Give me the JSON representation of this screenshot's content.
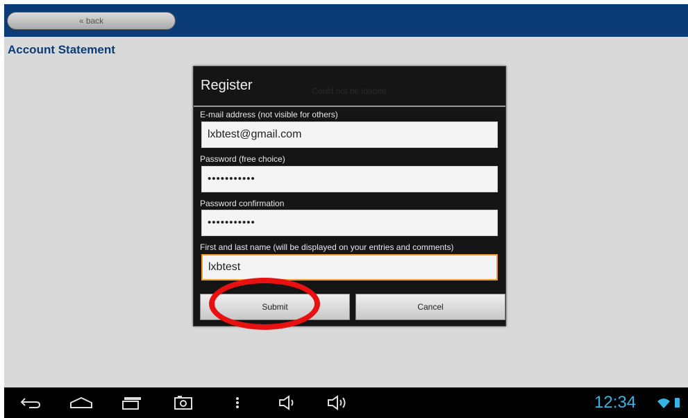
{
  "topbar": {
    "back_label": "« back"
  },
  "page": {
    "title": "Account Statement"
  },
  "dialog": {
    "title": "Register",
    "ghost_text": "Could not be loaded",
    "fields": [
      {
        "label": "E-mail address (not visible for others)",
        "value": "lxbtest@gmail.com",
        "type": "text"
      },
      {
        "label": "Password (free choice)",
        "value": "•••••••••••",
        "type": "password"
      },
      {
        "label": "Password confirmation",
        "value": "•••••••••••",
        "type": "password"
      },
      {
        "label": "First and last name (will be displayed on your entries and comments)",
        "value": "lxbtest",
        "type": "text",
        "focused": true
      }
    ],
    "submit_label": "Submit",
    "cancel_label": "Cancel"
  },
  "statusbar": {
    "time": "12:34"
  },
  "navbar": {
    "icons": [
      "back-icon",
      "home-icon",
      "recent-apps-icon",
      "screenshot-icon",
      "menu-icon",
      "volume-down-icon",
      "volume-up-icon"
    ]
  },
  "colors": {
    "header": "#0b3c78",
    "title_text": "#0b3c78",
    "focus_border": "#f29b26",
    "annotation_ring": "#e81010",
    "clock": "#33b5e5"
  }
}
